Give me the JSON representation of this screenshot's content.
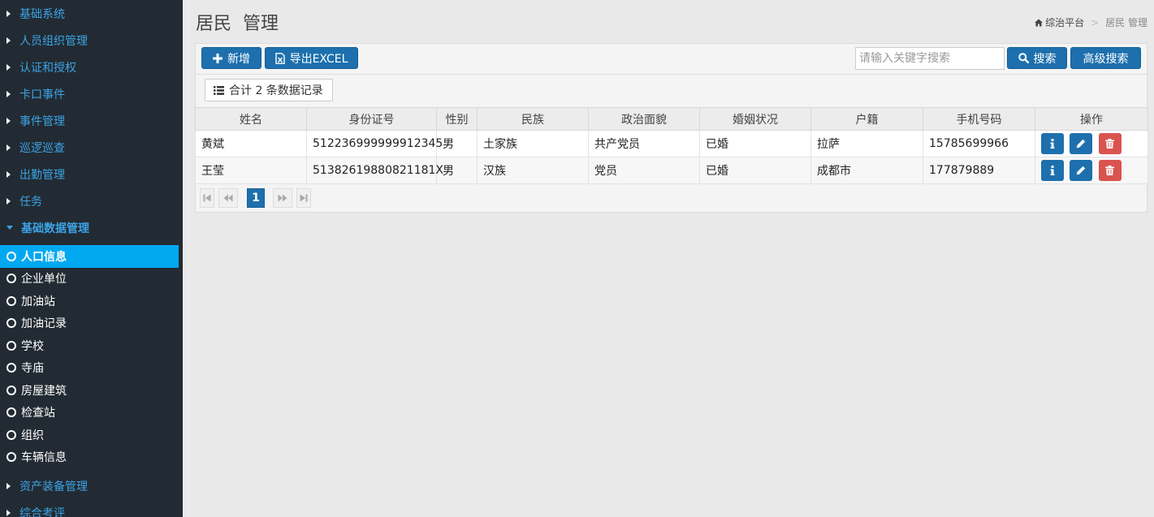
{
  "sidebar": {
    "top_items": [
      {
        "label": "基础系统"
      },
      {
        "label": "人员组织管理"
      },
      {
        "label": "认证和授权"
      },
      {
        "label": "卡口事件"
      },
      {
        "label": "事件管理"
      },
      {
        "label": "巡逻巡查"
      },
      {
        "label": "出勤管理"
      },
      {
        "label": "任务"
      },
      {
        "label": "基础数据管理"
      }
    ],
    "sub_items": [
      {
        "label": "人口信息"
      },
      {
        "label": "企业单位"
      },
      {
        "label": "加油站"
      },
      {
        "label": "加油记录"
      },
      {
        "label": "学校"
      },
      {
        "label": "寺庙"
      },
      {
        "label": "房屋建筑"
      },
      {
        "label": "检查站"
      },
      {
        "label": "组织"
      },
      {
        "label": "车辆信息"
      }
    ],
    "bottom_items": [
      {
        "label": "资产装备管理"
      },
      {
        "label": "综合考评"
      }
    ]
  },
  "header": {
    "title": "居民  管理",
    "breadcrumb_home": "综治平台",
    "breadcrumb_sep": ">",
    "breadcrumb_current": "居民 管理"
  },
  "toolbar": {
    "add_label": "新增",
    "export_label": "导出EXCEL",
    "search_placeholder": "请输入关键字搜索",
    "search_label": "搜索",
    "advanced_label": "高级搜索"
  },
  "summary": {
    "text": "合计 2 条数据记录"
  },
  "table": {
    "headers": [
      "姓名",
      "身份证号",
      "性别",
      "民族",
      "政治面貌",
      "婚姻状况",
      "户籍",
      "手机号码",
      "操作"
    ],
    "rows": [
      {
        "name": "黄斌",
        "id": "512236999999912345",
        "gender": "男",
        "ethnicity": "土家族",
        "political": "共产党员",
        "marital": "已婚",
        "household": "拉萨",
        "phone": "15785699966"
      },
      {
        "name": "王莹",
        "id": "51382619880821181X",
        "gender": "男",
        "ethnicity": "汉族",
        "political": "党员",
        "marital": "已婚",
        "household": "成都市",
        "phone": "177879889"
      }
    ]
  },
  "pager": {
    "current_page": "1"
  },
  "colors": {
    "sidebar_bg": "#222b33",
    "nav_text": "#3ca3e6",
    "active_bg": "#00a8f0",
    "primary_button": "#1d70ad",
    "danger_button": "#d9534f"
  },
  "icons": {
    "add": "plus-icon",
    "export": "excel-file-icon",
    "search": "search-icon",
    "summary": "list-icon",
    "info": "info-icon",
    "edit": "pencil-icon",
    "delete": "trash-icon",
    "home": "home-icon"
  }
}
